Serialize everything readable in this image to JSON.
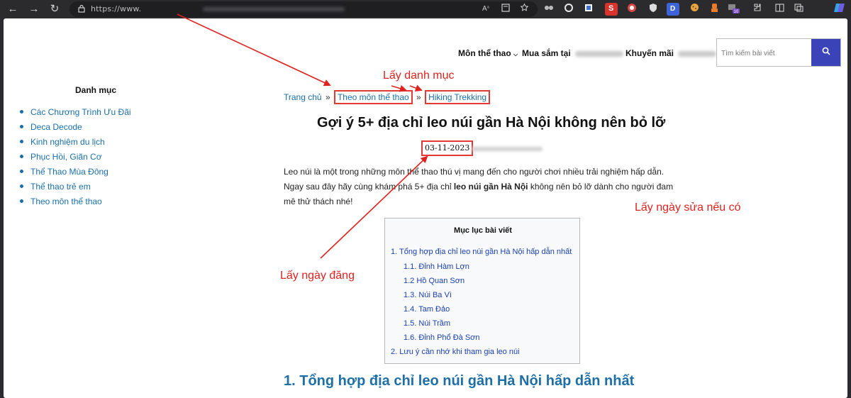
{
  "browser": {
    "url_prefix": "https://www.",
    "nav": {
      "back": "←",
      "forward": "→",
      "reload": "↻"
    },
    "toolbar_icons": [
      "read-aloud-icon",
      "immersive-reader-icon",
      "favorite-star-icon",
      "extension-a-icon",
      "extension-b-icon",
      "extension-c-icon",
      "extension-d-icon",
      "extension-e-icon",
      "extension-f-icon",
      "extension-g-icon",
      "extension-h-icon",
      "extension-i-icon",
      "extension-j-icon",
      "extensions-icon",
      "split-screen-icon",
      "collections-icon",
      "copilot-icon"
    ],
    "badge": "10"
  },
  "topnav": {
    "sports": "Môn thể thao",
    "shopping": "Mua sắm tại",
    "promo": "Khuyến mãi"
  },
  "search": {
    "placeholder": "Tìm kiếm bài viết"
  },
  "sidebar": {
    "title": "Danh mục",
    "items": [
      "Các Chương Trình Ưu Đãi",
      "Deca Decode",
      "Kinh nghiệm du lịch",
      "Phục Hồi, Giãn Cơ",
      "Thể Thao Mùa Đông",
      "Thể thao trẻ em",
      "Theo môn thể thao"
    ]
  },
  "breadcrumb": {
    "home": "Trang chủ",
    "sep": "»",
    "category": "Theo môn thể thao",
    "subcategory": "Hiking Trekking"
  },
  "post": {
    "title": "Gợi ý 5+ địa chỉ leo núi gần Hà Nội không nên bỏ lỡ",
    "date": "03-11-2023",
    "intro_part1": "Leo núi là một trong những môn thể thao thú vị mang đến cho người chơi nhiều trải nghiệm hấp dẫn. Ngay sau đây hãy cùng khám phá 5+ địa chỉ ",
    "intro_bold": "leo núi gần Hà Nội",
    "intro_part2": " không nên bỏ lỡ dành cho người đam mê thử thách nhé!"
  },
  "toc": {
    "title": "Mục lục bài viết",
    "items": [
      "1. Tổng hợp địa chỉ leo núi gần Hà Nội hấp dẫn nhất",
      "1.1. Đỉnh Hàm Lợn",
      "1.2 Hồ Quan Sơn",
      "1.3. Núi Ba Vì",
      "1.4. Tam Đảo",
      "1.5. Núi Trầm",
      "1.6. Đỉnh Phổ Đà Sơn",
      "2. Lưu ý cần nhớ khi tham gia leo núi"
    ]
  },
  "section": {
    "heading": "1. Tổng hợp địa chỉ leo núi gần Hà Nội hấp dẫn nhất"
  },
  "annotations": {
    "category": "Lấy danh mục",
    "published": "Lấy ngày đăng",
    "modified": "Lấy ngày sửa nếu có",
    "color": "#e0221f"
  }
}
